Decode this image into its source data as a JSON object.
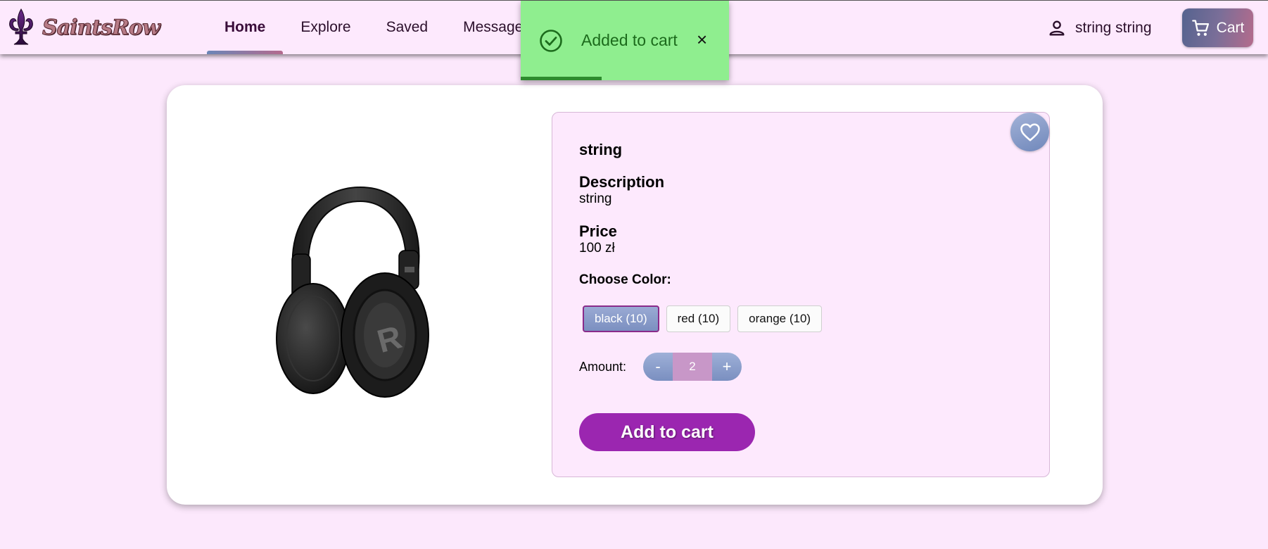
{
  "brand": {
    "logo_text": "SaintsRow"
  },
  "nav": {
    "tabs": [
      {
        "label": "Home",
        "active": true
      },
      {
        "label": "Explore"
      },
      {
        "label": "Saved"
      },
      {
        "label": "Messages"
      }
    ]
  },
  "user": {
    "name": "string string",
    "icon": "person-icon"
  },
  "cart": {
    "label": "Cart",
    "icon": "shopping-cart-icon"
  },
  "toast": {
    "message": "Added to cart",
    "close_symbol": "×",
    "icon": "check-circle-icon",
    "progress": 0.39,
    "color": "#8fee8f"
  },
  "product": {
    "name": "string",
    "description_label": "Description",
    "description": "string",
    "price_label": "Price",
    "price": "100 zł",
    "color_label": "Choose Color:",
    "colors": [
      {
        "label": "black (10)",
        "selected": true
      },
      {
        "label": "red (10)"
      },
      {
        "label": "orange (10)"
      }
    ],
    "amount_label": "Amount:",
    "amount": "2",
    "minus": "-",
    "plus": "+",
    "add_button": "Add to cart",
    "image": "headphones-image",
    "favorite_icon": "heart-icon"
  },
  "colors": {
    "background": "#fce8fc",
    "accent_purple": "#9b26b0",
    "toast_green": "#8fee8f"
  }
}
